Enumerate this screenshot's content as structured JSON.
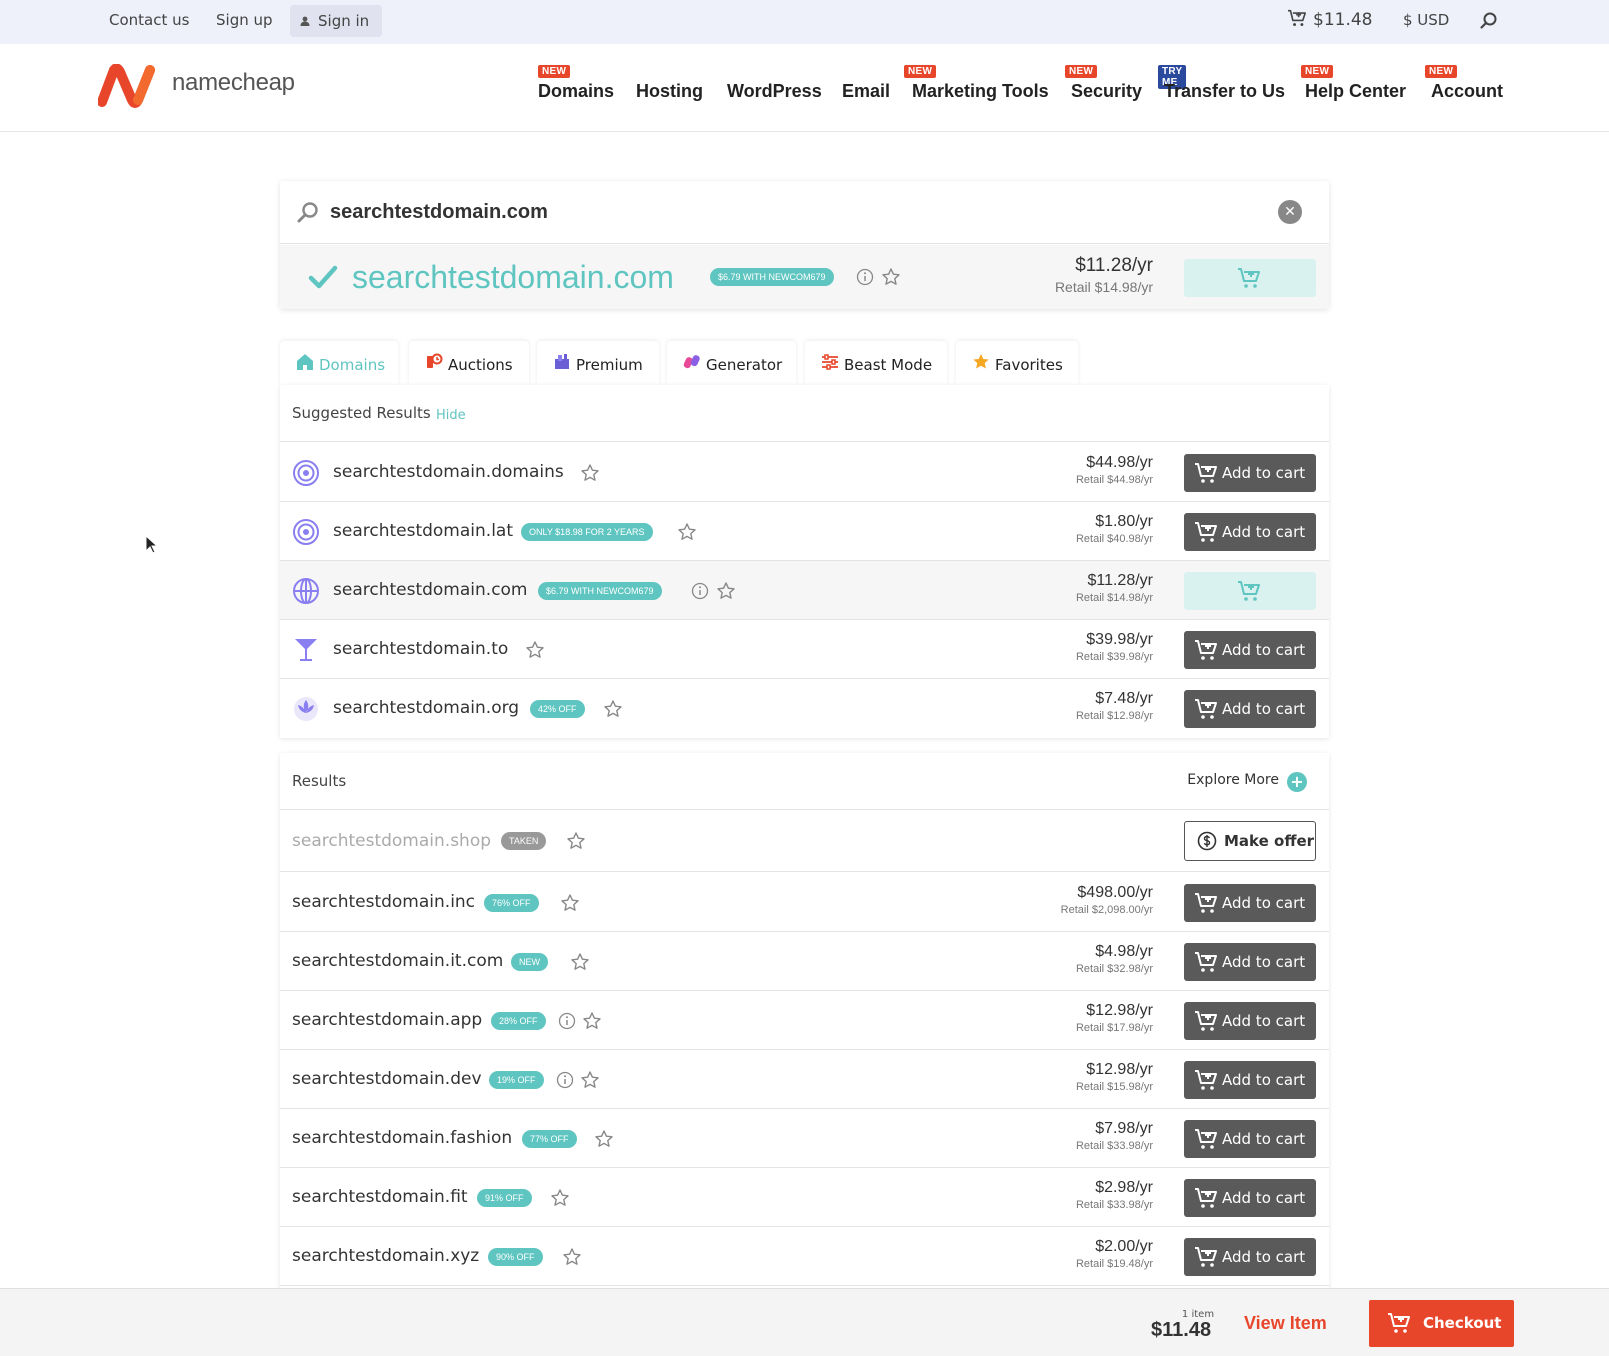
{
  "topbar": {
    "contact": "Contact us",
    "signup": "Sign up",
    "signin": "Sign in",
    "cart_total": "$11.48",
    "currency": "$ USD"
  },
  "brand": {
    "name": "namecheap",
    "accent": "#e8462b",
    "teal": "#5fc5c0"
  },
  "nav": [
    {
      "label": "Domains",
      "badge": "NEW"
    },
    {
      "label": "Hosting",
      "badge": ""
    },
    {
      "label": "WordPress",
      "badge": ""
    },
    {
      "label": "Email",
      "badge": ""
    },
    {
      "label": "Marketing Tools",
      "badge": "NEW"
    },
    {
      "label": "Security",
      "badge": "NEW"
    },
    {
      "label": "Transfer to Us",
      "badge": "TRY ME"
    },
    {
      "label": "Help Center",
      "badge": "NEW"
    },
    {
      "label": "Account",
      "badge": "NEW"
    }
  ],
  "search": {
    "query": "searchtestdomain.com",
    "result_name": "searchtestdomain.com",
    "result_badge": "$6.79 WITH NEWCOM679",
    "result_price": "$11.28/yr",
    "result_retail": "Retail $14.98/yr"
  },
  "tabs": [
    {
      "label": "Domains",
      "icon": "home-icon"
    },
    {
      "label": "Auctions",
      "icon": "auction-icon"
    },
    {
      "label": "Premium",
      "icon": "premium-icon"
    },
    {
      "label": "Generator",
      "icon": "generator-icon"
    },
    {
      "label": "Beast Mode",
      "icon": "sliders-icon"
    },
    {
      "label": "Favorites",
      "icon": "star-icon"
    }
  ],
  "suggested": {
    "title": "Suggested Results",
    "hide": "Hide",
    "rows": [
      {
        "name": "searchtestdomain.domains",
        "badge": "",
        "price": "$44.98/yr",
        "retail": "Retail $44.98/yr",
        "action": "Add to cart"
      },
      {
        "name": "searchtestdomain.lat",
        "badge": "ONLY $18.98 FOR 2 YEARS",
        "price": "$1.80/yr",
        "retail": "Retail $40.98/yr",
        "action": "Add to cart"
      },
      {
        "name": "searchtestdomain.com",
        "badge": "$6.79 WITH NEWCOM679",
        "price": "$11.28/yr",
        "retail": "Retail $14.98/yr",
        "action": ""
      },
      {
        "name": "searchtestdomain.to",
        "badge": "",
        "price": "$39.98/yr",
        "retail": "Retail $39.98/yr",
        "action": "Add to cart"
      },
      {
        "name": "searchtestdomain.org",
        "badge": "42% OFF",
        "price": "$7.48/yr",
        "retail": "Retail $12.98/yr",
        "action": "Add to cart"
      }
    ]
  },
  "results": {
    "title": "Results",
    "explore": "Explore More",
    "rows": [
      {
        "name": "searchtestdomain.shop",
        "badge": "TAKEN",
        "price": "",
        "retail": "",
        "action": "Make offer"
      },
      {
        "name": "searchtestdomain.inc",
        "badge": "76% OFF",
        "price": "$498.00/yr",
        "retail": "Retail $2,098.00/yr",
        "action": "Add to cart"
      },
      {
        "name": "searchtestdomain.it.com",
        "badge": "NEW",
        "price": "$4.98/yr",
        "retail": "Retail $32.98/yr",
        "action": "Add to cart"
      },
      {
        "name": "searchtestdomain.app",
        "badge": "28% OFF",
        "price": "$12.98/yr",
        "retail": "Retail $17.98/yr",
        "action": "Add to cart"
      },
      {
        "name": "searchtestdomain.dev",
        "badge": "19% OFF",
        "price": "$12.98/yr",
        "retail": "Retail $15.98/yr",
        "action": "Add to cart"
      },
      {
        "name": "searchtestdomain.fashion",
        "badge": "77% OFF",
        "price": "$7.98/yr",
        "retail": "Retail $33.98/yr",
        "action": "Add to cart"
      },
      {
        "name": "searchtestdomain.fit",
        "badge": "91% OFF",
        "price": "$2.98/yr",
        "retail": "Retail $33.98/yr",
        "action": "Add to cart"
      },
      {
        "name": "searchtestdomain.xyz",
        "badge": "90% OFF",
        "price": "$2.00/yr",
        "retail": "Retail $19.48/yr",
        "action": "Add to cart"
      }
    ]
  },
  "bottombar": {
    "items": "1 item",
    "total": "$11.48",
    "view": "View Item",
    "checkout": "Checkout"
  }
}
